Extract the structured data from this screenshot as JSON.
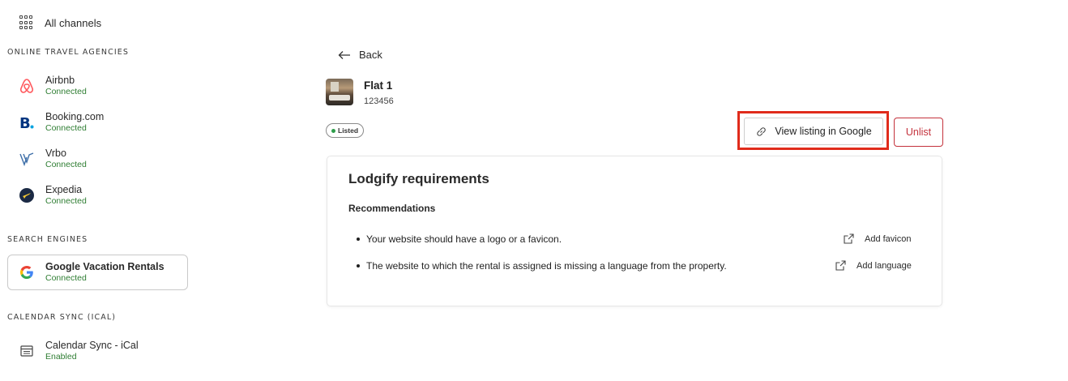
{
  "sidebar": {
    "all_channels_label": "All channels",
    "sections": {
      "ota": "ONLINE TRAVEL AGENCIES",
      "search": "SEARCH ENGINES",
      "calendar": "CALENDAR SYNC (ICAL)"
    },
    "channels": [
      {
        "name": "Airbnb",
        "status": "Connected",
        "icon": "airbnb-logo"
      },
      {
        "name": "Booking.com",
        "status": "Connected",
        "icon": "booking-logo"
      },
      {
        "name": "Vrbo",
        "status": "Connected",
        "icon": "vrbo-logo"
      },
      {
        "name": "Expedia",
        "status": "Connected",
        "icon": "expedia-logo"
      },
      {
        "name": "Google Vacation Rentals",
        "status": "Connected",
        "icon": "google-logo"
      },
      {
        "name": "Calendar Sync - iCal",
        "status": "Enabled",
        "icon": "calendar-icon"
      }
    ]
  },
  "main": {
    "back_label": "Back",
    "property": {
      "name": "Flat 1",
      "id": "123456"
    },
    "badge": "Listed",
    "buttons": {
      "view_google": "View listing in Google",
      "unlist": "Unlist"
    },
    "card": {
      "title": "Lodgify requirements",
      "subtitle": "Recommendations",
      "items": [
        {
          "text": "Your website should have a logo or a favicon.",
          "action": "Add favicon"
        },
        {
          "text": "The website to which the rental is assigned is missing a language from the property.",
          "action": "Add language"
        }
      ]
    }
  },
  "colors": {
    "connected_green": "#2e7d32",
    "unlist_red": "#c4323c",
    "highlight_red": "#e02b1b",
    "airbnb": "#ff5a5f",
    "booking": "#003580",
    "expedia": "#1b2a44"
  }
}
